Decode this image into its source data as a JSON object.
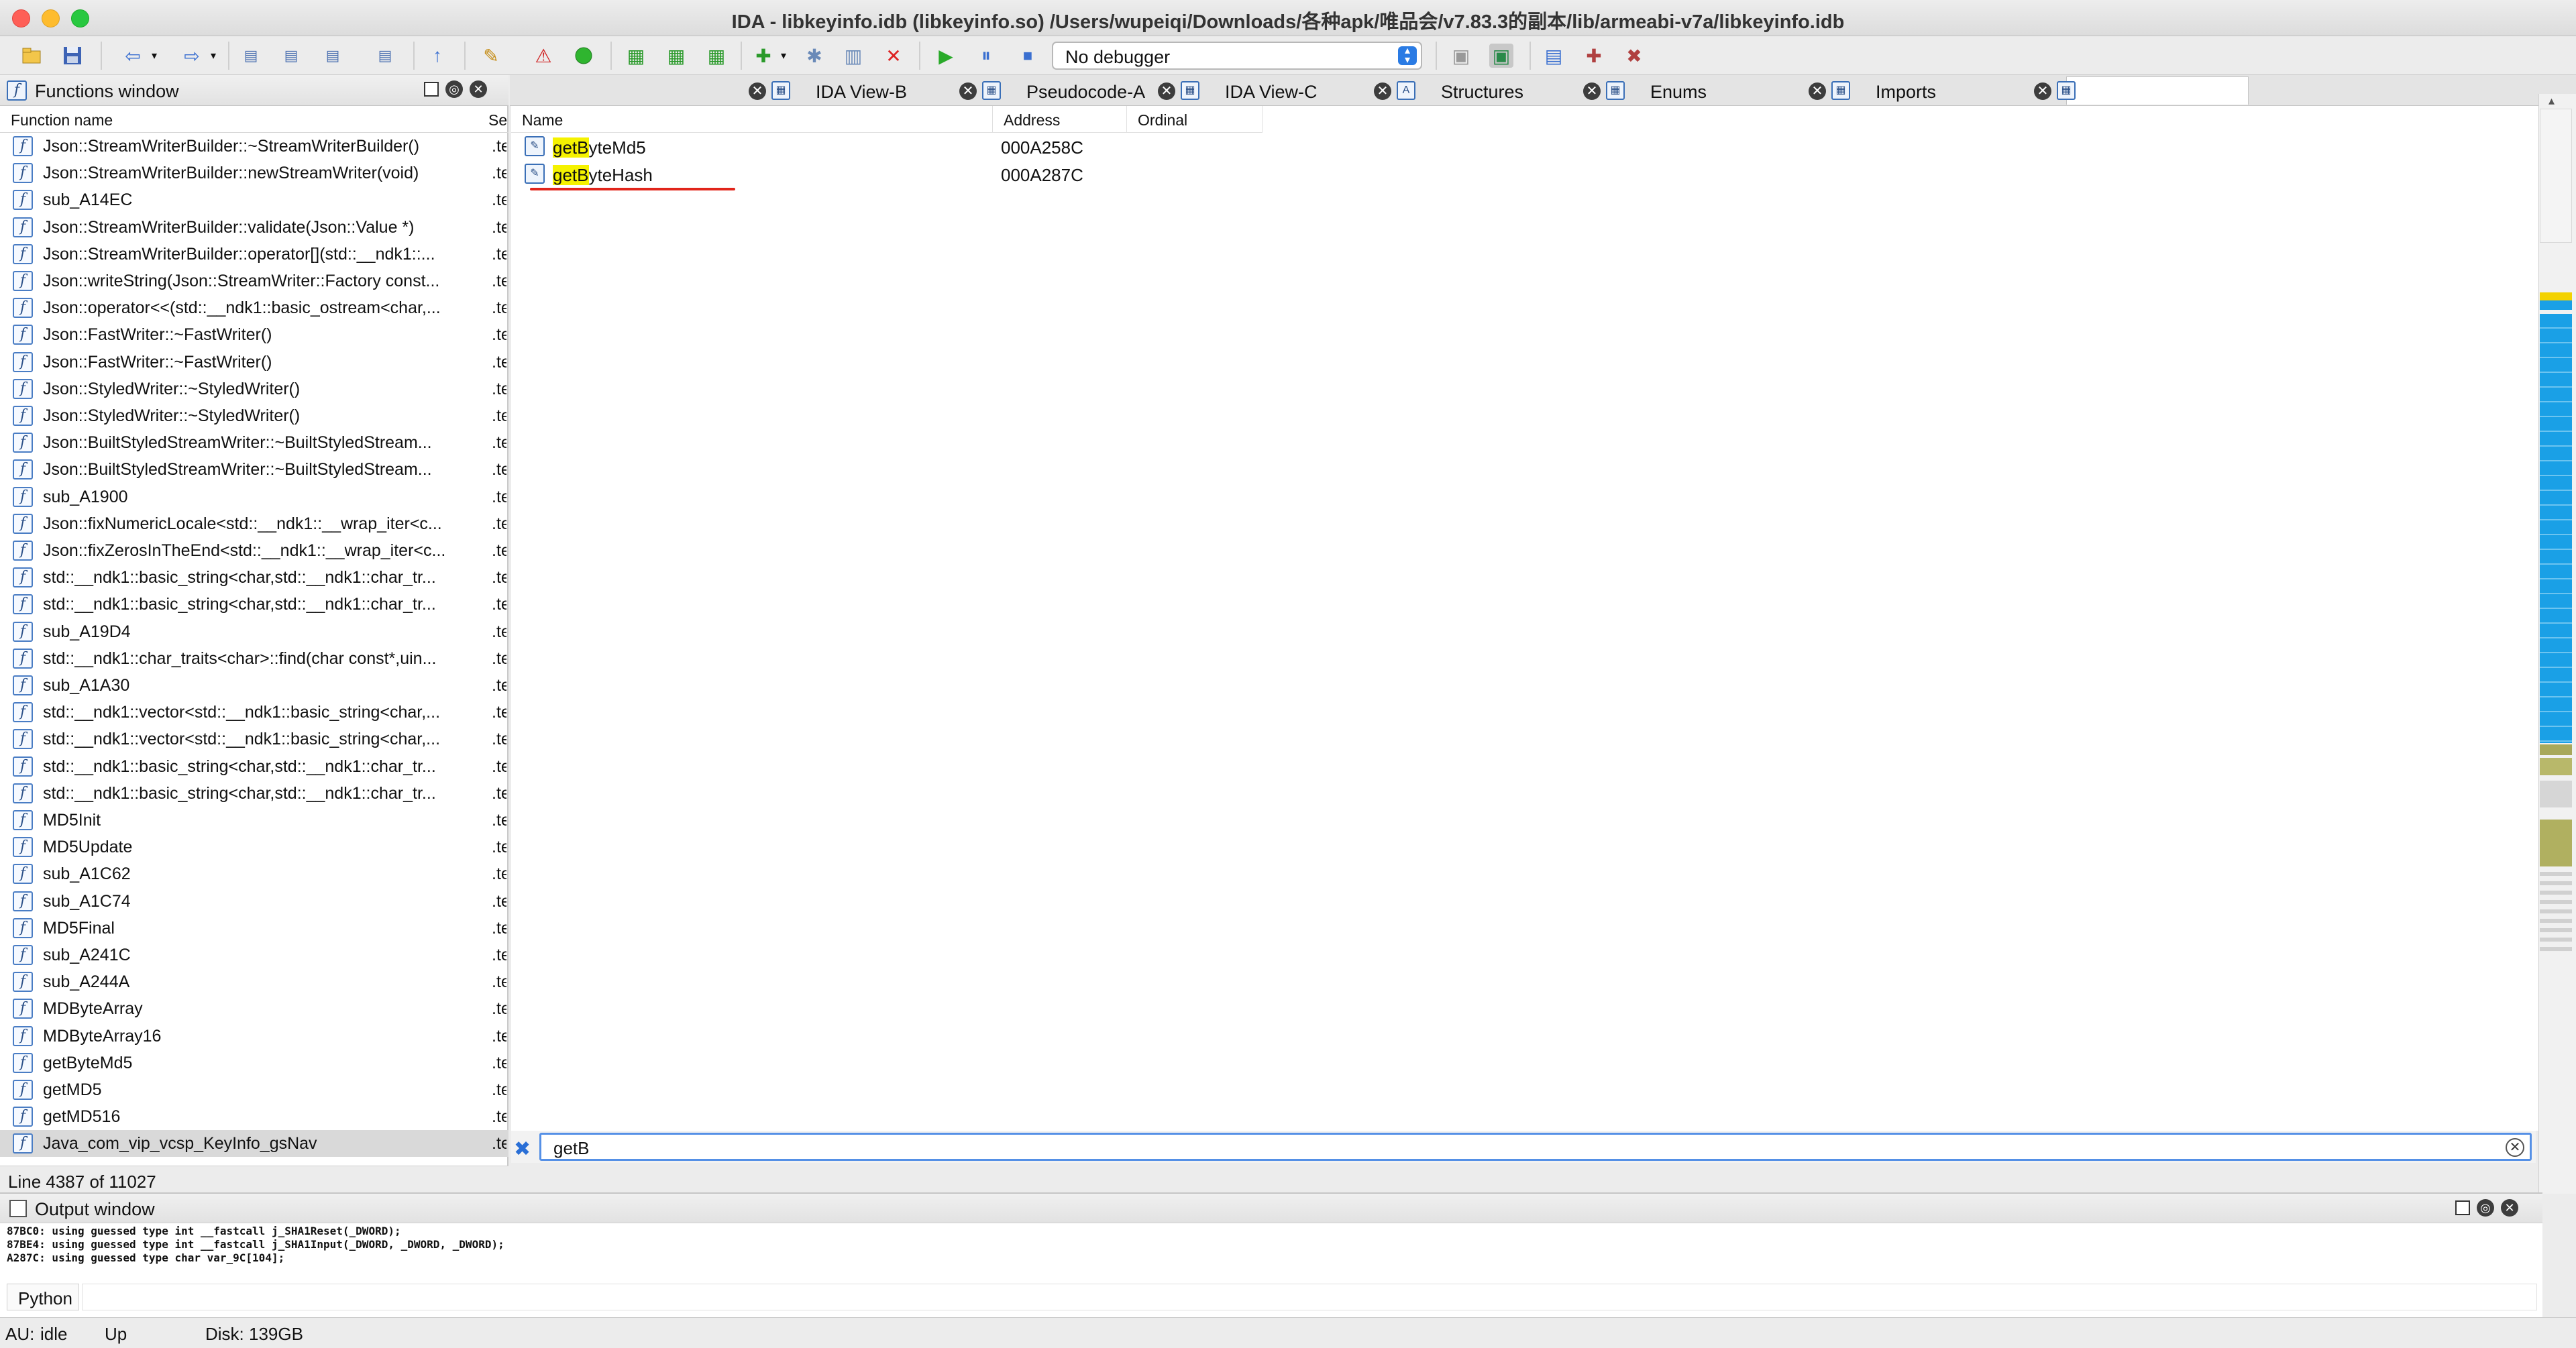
{
  "window": {
    "title": "IDA - libkeyinfo.idb (libkeyinfo.so) /Users/wupeiqi/Downloads/各种apk/唯品会/v7.83.3的副本/lib/armeabi-v7a/libkeyinfo.idb"
  },
  "toolbar": {
    "debugger_label": "No debugger"
  },
  "functions_window": {
    "title": "Functions window",
    "columns": [
      "Function name",
      "Se"
    ],
    "items": [
      "Json::StreamWriterBuilder::~StreamWriterBuilder()",
      "Json::StreamWriterBuilder::newStreamWriter(void)",
      "sub_A14EC",
      "Json::StreamWriterBuilder::validate(Json::Value *)",
      "Json::StreamWriterBuilder::operator[](std::__ndk1::...",
      "Json::writeString(Json::StreamWriter::Factory const...",
      "Json::operator<<(std::__ndk1::basic_ostream<char,...",
      "Json::FastWriter::~FastWriter()",
      "Json::FastWriter::~FastWriter()",
      "Json::StyledWriter::~StyledWriter()",
      "Json::StyledWriter::~StyledWriter()",
      "Json::BuiltStyledStreamWriter::~BuiltStyledStream...",
      "Json::BuiltStyledStreamWriter::~BuiltStyledStream...",
      "sub_A1900",
      "Json::fixNumericLocale<std::__ndk1::__wrap_iter<c...",
      "Json::fixZerosInTheEnd<std::__ndk1::__wrap_iter<c...",
      "std::__ndk1::basic_string<char,std::__ndk1::char_tr...",
      "std::__ndk1::basic_string<char,std::__ndk1::char_tr...",
      "sub_A19D4",
      "std::__ndk1::char_traits<char>::find(char const*,uin...",
      "sub_A1A30",
      "std::__ndk1::vector<std::__ndk1::basic_string<char,...",
      "std::__ndk1::vector<std::__ndk1::basic_string<char,...",
      "std::__ndk1::basic_string<char,std::__ndk1::char_tr...",
      "std::__ndk1::basic_string<char,std::__ndk1::char_tr...",
      "MD5Init",
      "MD5Update",
      "sub_A1C62",
      "sub_A1C74",
      "MD5Final",
      "sub_A241C",
      "sub_A244A",
      "MDByteArray",
      "MDByteArray16",
      "getByteMd5",
      "getMD5",
      "getMD516",
      "Java_com_vip_vcsp_KeyInfo_gsNav"
    ],
    "segment": ".te",
    "selected_index": 37,
    "status": "Line 4387 of 11027"
  },
  "tabs": [
    {
      "label": "IDA View-B",
      "icon": "ida-view-icon"
    },
    {
      "label": "Pseudocode-A",
      "icon": "pseudocode-icon"
    },
    {
      "label": "IDA View-C",
      "icon": "ida-view-icon"
    },
    {
      "label": "Structures",
      "icon": "structures-icon",
      "glyph": "A"
    },
    {
      "label": "Enums",
      "icon": "enums-icon"
    },
    {
      "label": "Imports",
      "icon": "imports-icon"
    },
    {
      "label": "",
      "icon": "exports-icon",
      "active": true
    }
  ],
  "exports": {
    "columns": [
      "Name",
      "Address",
      "Ordinal"
    ],
    "rows": [
      {
        "match": "getB",
        "rest": "yteMd5",
        "address": "000A258C",
        "ordinal": ""
      },
      {
        "match": "getB",
        "rest": "yteHash",
        "address": "000A287C",
        "ordinal": ""
      }
    ]
  },
  "search": {
    "value": "getB"
  },
  "output_window": {
    "title": "Output window",
    "lines": [
      "87BC0: using guessed type int __fastcall j_SHA1Reset(_DWORD);",
      "87BE4: using guessed type int __fastcall j_SHA1Input(_DWORD, _DWORD, _DWORD);",
      "A287C: using guessed type char var_9C[104];"
    ],
    "input_lang": "Python"
  },
  "status_bar": {
    "au": "AU:",
    "state": "idle",
    "direction": "Up",
    "disk": "Disk: 139GB"
  },
  "colors": {
    "highlight": "#f5f200",
    "underline": "#e1251b",
    "accent": "#2a7be4"
  }
}
